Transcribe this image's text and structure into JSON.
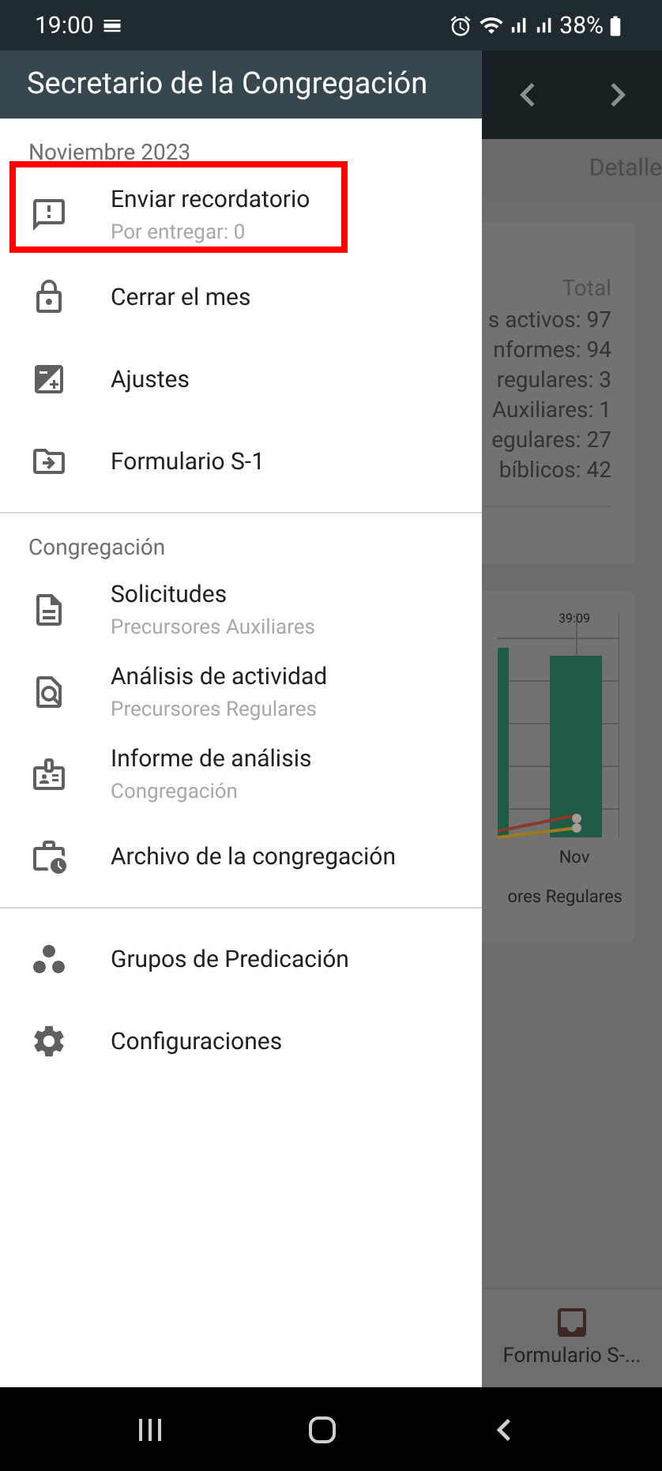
{
  "status_bar": {
    "time": "19:00",
    "battery": "38%"
  },
  "drawer": {
    "title": "Secretario de la Congregación",
    "sections": [
      {
        "header": "Noviembre 2023",
        "items": [
          {
            "label": "Enviar recordatorio",
            "subtitle": "Por entregar: 0",
            "highlighted": true
          },
          {
            "label": "Cerrar el mes",
            "highlighted": false
          },
          {
            "label": "Ajustes",
            "highlighted": false
          },
          {
            "label": "Formulario S-1",
            "highlighted": false
          }
        ]
      },
      {
        "header": "Congregación",
        "items": [
          {
            "label": "Solicitudes",
            "subtitle": "Precursores Auxiliares",
            "highlighted": false
          },
          {
            "label": "Análisis de actividad",
            "subtitle": "Precursores Regulares",
            "highlighted": false
          },
          {
            "label": "Informe de análisis",
            "subtitle": "Congregación",
            "highlighted": false
          },
          {
            "label": "Archivo de la congregación",
            "highlighted": false
          }
        ]
      },
      {
        "items": [
          {
            "label": "Grupos de Predicación",
            "highlighted": false
          },
          {
            "label": "Configuraciones",
            "highlighted": false
          }
        ]
      }
    ]
  },
  "background": {
    "tab": "Detalle",
    "totals": {
      "header": "Total",
      "lines": [
        "s activos: 97",
        "nformes: 94",
        "regulares: 3",
        "Auxiliares: 1",
        "egulares: 27",
        "bíblicos: 42"
      ]
    },
    "chart": {
      "bar_label": "39:09",
      "category": "Nov",
      "legend": "ores Regulares"
    },
    "bottom_tab": "Formulario S-..."
  }
}
